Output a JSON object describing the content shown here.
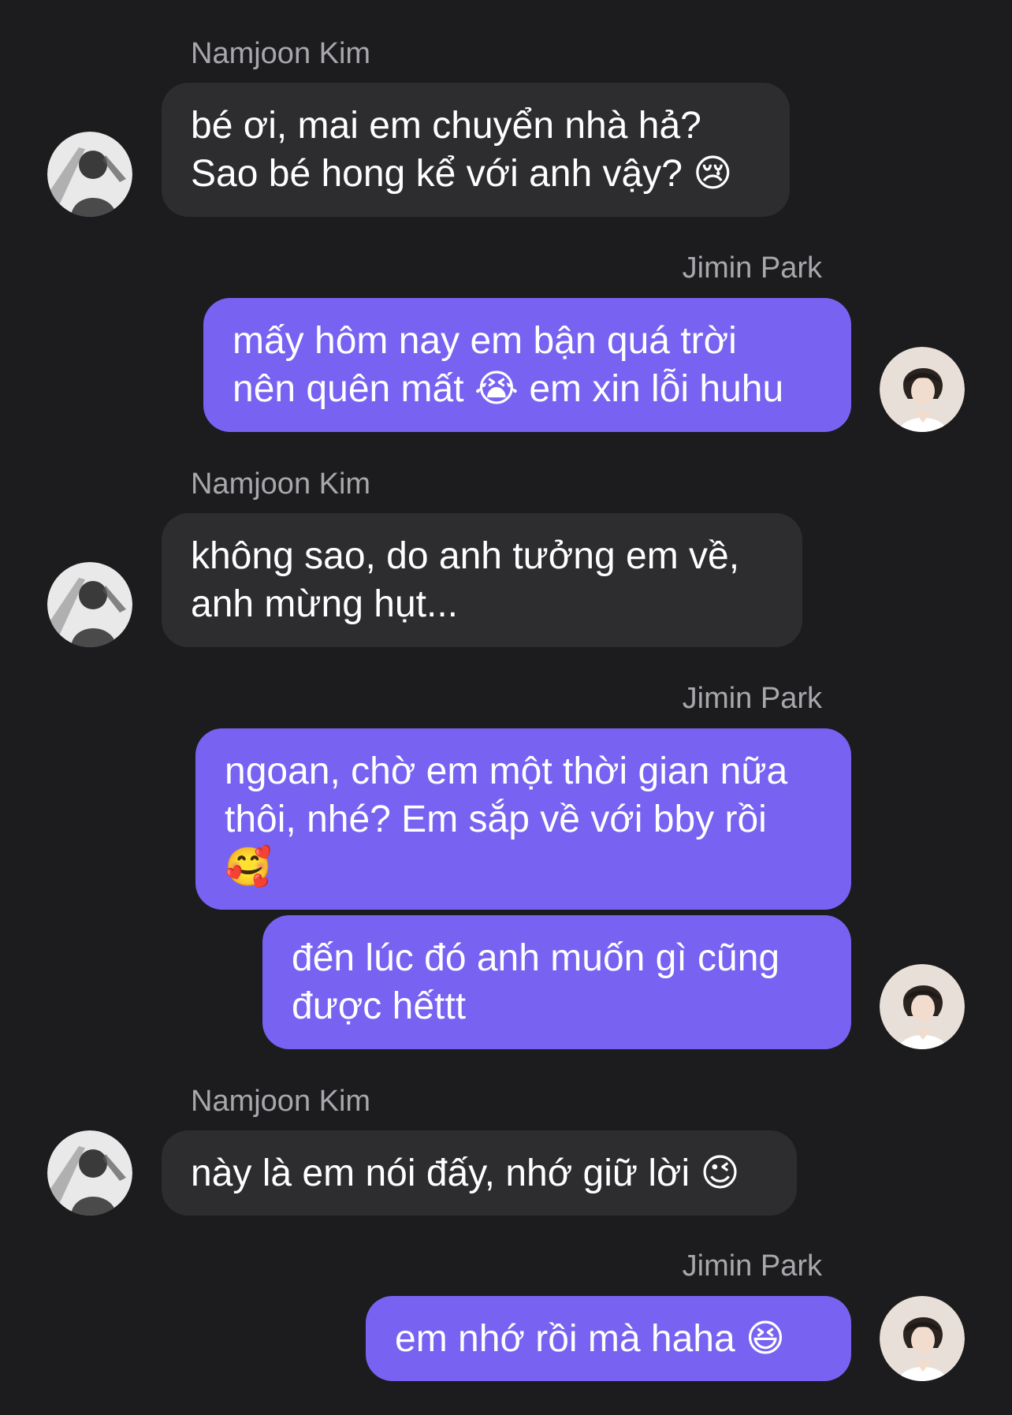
{
  "contacts": {
    "namjoon": "Namjoon Kim",
    "jimin": "Jimin Park"
  },
  "messages": [
    {
      "sender": "Namjoon Kim",
      "text": "bé ơi, mai em chuyển nhà hả?\nSao bé hong kể với anh vậy? 😢"
    },
    {
      "sender": "Jimin Park",
      "text": "mấy hôm nay em bận quá trời\nnên quên mất 😭 em xin lỗi huhu"
    },
    {
      "sender": "Namjoon Kim",
      "text": "không sao, do anh tưởng em về,\nanh mừng hụt..."
    },
    {
      "sender": "Jimin Park",
      "text": "ngoan, chờ em một thời gian nữa\nthôi, nhé? Em sắp về với bby rồi\n🥰"
    },
    {
      "sender": "Jimin Park",
      "text": "đến lúc đó anh muốn gì cũng\nđược hếttt"
    },
    {
      "sender": "Namjoon Kim",
      "text": "này là em nói đấy, nhớ giữ lời 😉"
    },
    {
      "sender": "Jimin Park",
      "text": "em nhớ rồi mà haha 😆"
    }
  ],
  "colors": {
    "background": "#1c1c1e",
    "incoming_bubble": "#2d2d30",
    "outgoing_bubble": "#7762f2",
    "sender_name": "#a7a7ac",
    "message_text": "#ffffff"
  },
  "icons": {
    "namjoon_avatar": "avatar-photo-grayscale",
    "jimin_avatar": "avatar-photo-light"
  }
}
